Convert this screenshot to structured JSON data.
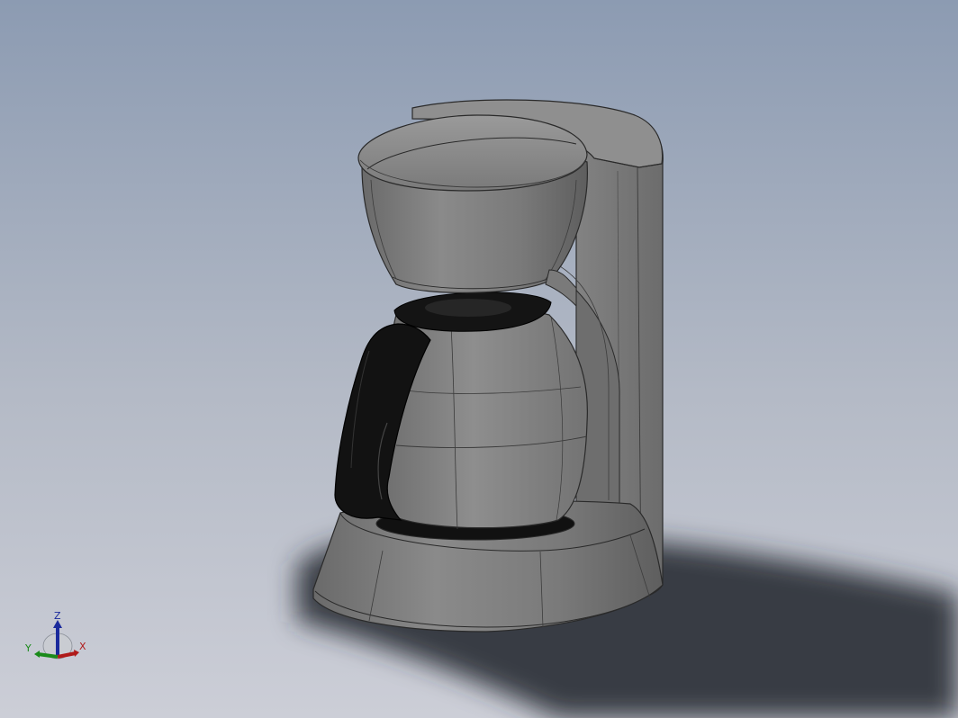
{
  "viewport": {
    "background_top": "#8d9cb3",
    "background_bottom": "#c9ccd5",
    "model": "coffee-maker"
  },
  "colors": {
    "body_gray": "#7c7c7c",
    "body_light": "#9a9a9a",
    "body_dark": "#5e5e5e",
    "edge": "#2a2a2a",
    "handle_black": "#121212",
    "shadow": "#262a30"
  },
  "triad": {
    "z_label": "Z",
    "x_label": "X",
    "y_label": "Y",
    "z_color": "#1a2a9c",
    "x_color": "#b01a1a",
    "y_color": "#1a8a1a"
  }
}
